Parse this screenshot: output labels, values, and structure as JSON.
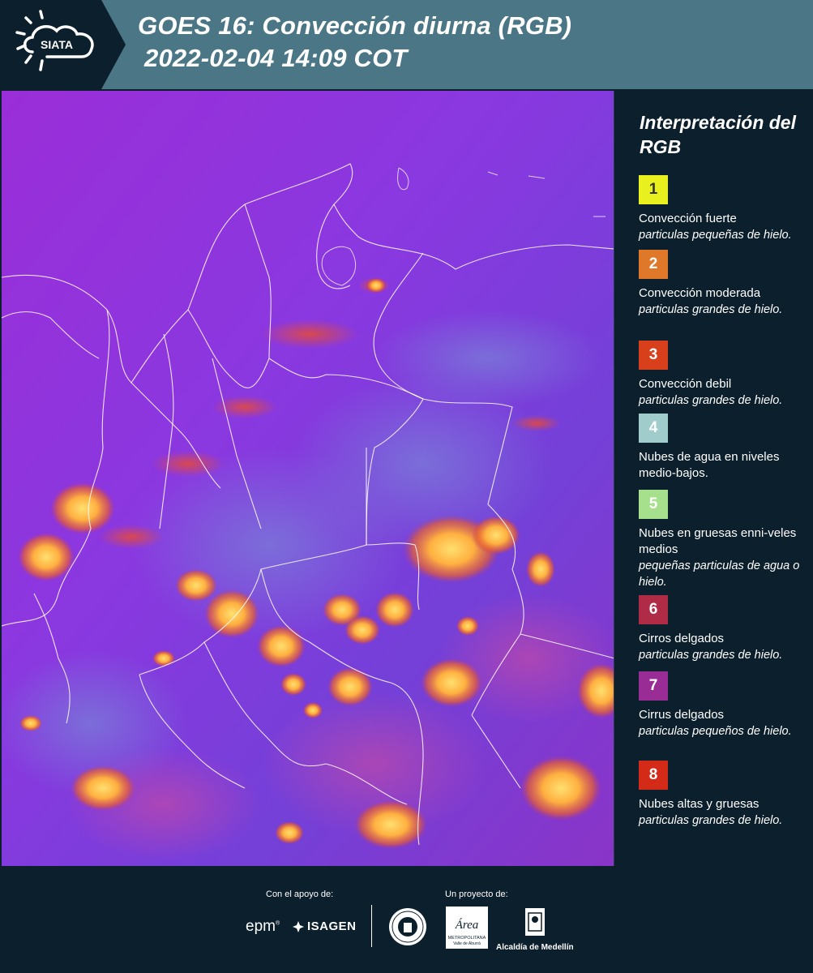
{
  "header": {
    "logo_text": "SIATA",
    "title_line1": "GOES 16: Convección diurna (RGB)",
    "title_line2": "2022-02-04 14:09 COT"
  },
  "legend": {
    "title": "Interpretación del RGB",
    "items": [
      {
        "number": "1",
        "color": "#e8f01e",
        "text_color": "#333333",
        "name": "Convección fuerte",
        "desc": "particulas pequeñas de hielo."
      },
      {
        "number": "2",
        "color": "#e0782a",
        "text_color": "#ffffff",
        "name": "Convección moderada",
        "desc": "particulas grandes de hielo."
      },
      {
        "number": "3",
        "color": "#d8401c",
        "text_color": "#ffffff",
        "name": "Convección debil",
        "desc": "particulas grandes de hielo."
      },
      {
        "number": "4",
        "color": "#a0cccc",
        "text_color": "#ffffff",
        "name": "Nubes de agua en niveles medio-bajos.",
        "desc": ""
      },
      {
        "number": "5",
        "color": "#a6e08c",
        "text_color": "#ffffff",
        "name": "Nubes en gruesas enni-veles medios",
        "desc": "pequeñas particulas de agua o hielo."
      },
      {
        "number": "6",
        "color": "#b02c46",
        "text_color": "#ffffff",
        "name": "Cirros delgados",
        "desc": "particulas grandes de hielo."
      },
      {
        "number": "7",
        "color": "#9a2c96",
        "text_color": "#ffffff",
        "name": "Cirrus delgados",
        "desc": "particulas pequeños de hielo."
      },
      {
        "number": "8",
        "color": "#d42a18",
        "text_color": "#ffffff",
        "name": "Nubes altas y gruesas",
        "desc": "particulas grandes de hielo."
      }
    ]
  },
  "footer": {
    "support_label": "Con el apoyo de:",
    "project_label": "Un proyecto de:",
    "epm": "epm",
    "isagen": "ISAGEN",
    "amva": "Área",
    "amva_sub": "METROPOLITANA",
    "amva_sub2": "Valle de Aburrá",
    "medellin": "Alcaldía de Medellín"
  },
  "colors": {
    "header_bg": "#4a7686",
    "page_bg": "#0c1f2c",
    "map_base": "#8a2ed6"
  }
}
